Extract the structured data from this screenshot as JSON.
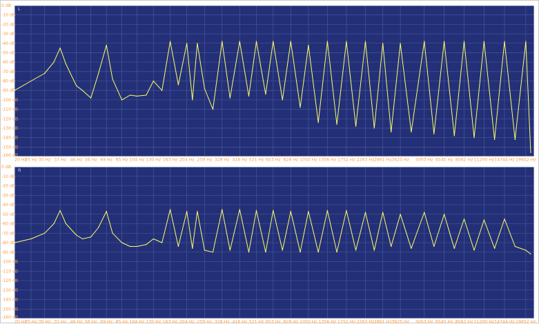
{
  "colors": {
    "plot_background": "#233078",
    "grid": "#4f5c9c",
    "trace": "#ffff66",
    "tick_label": "#ff9a3c",
    "frame": "#ffffff"
  },
  "chart_data": [
    {
      "type": "line",
      "channel_label": "L",
      "x_scale": "log",
      "y_unit": "dB",
      "ylim": [
        -160,
        0
      ],
      "y_ticks": [
        "0 dB",
        "-10 dB",
        "-20 dB",
        "-30 dB",
        "-40 dB",
        "-50 dB",
        "-60 dB",
        "-70 dB",
        "-80 dB",
        "-90 dB",
        "-100 dB",
        "-110 dB",
        "-120 dB",
        "-130 dB",
        "-140 dB",
        "-150 dB",
        "-160 dB"
      ],
      "x_ticks": [
        "20 Hz",
        "25 Hz",
        "30 Hz",
        "37 Hz",
        "46 Hz",
        "56 Hz",
        "69 Hz",
        "85 Hz",
        "104 Hz",
        "130 Hz",
        "163 Hz",
        "204 Hz",
        "259 Hz",
        "328 Hz",
        "416 Hz",
        "521 Hz",
        "653 Hz",
        "828 Hz",
        "1050 Hz",
        "1356 Hz",
        "1752 Hz",
        "2263 Hz",
        "2861 Hz",
        "3625 Hz",
        "5003 Hz",
        "6545 Hz",
        "8562 Hz",
        "11200 Hz",
        "14744 Hz",
        "19652 Hz"
      ],
      "grid": true,
      "series": [
        {
          "x": [
            20,
            25,
            30,
            34,
            37,
            40,
            46,
            50,
            56,
            62,
            69,
            75,
            85,
            95,
            104,
            118,
            130,
            146,
            163,
            182,
            204,
            220,
            235,
            259,
            290,
            328,
            365,
            416,
            470,
            521,
            590,
            653,
            740,
            828,
            940,
            1050,
            1200,
            1356,
            1540,
            1752,
            1990,
            2263,
            2550,
            2861,
            3200,
            3625,
            4200,
            5003,
            5700,
            6545,
            7500,
            8562,
            9800,
            11200,
            12900,
            14744,
            17000,
            19652,
            21000
          ],
          "y": [
            -90,
            -80,
            -72,
            -60,
            -45,
            -62,
            -85,
            -90,
            -98,
            -72,
            -42,
            -78,
            -100,
            -95,
            -96,
            -95,
            -80,
            -90,
            -38,
            -84,
            -40,
            -100,
            -40,
            -88,
            -110,
            -38,
            -98,
            -38,
            -96,
            -38,
            -94,
            -38,
            -100,
            -38,
            -108,
            -42,
            -124,
            -38,
            -126,
            -38,
            -128,
            -38,
            -130,
            -40,
            -134,
            -40,
            -134,
            -38,
            -136,
            -38,
            -138,
            -38,
            -140,
            -38,
            -142,
            -38,
            -142,
            -38,
            -156
          ]
        }
      ]
    },
    {
      "type": "line",
      "channel_label": "R",
      "x_scale": "log",
      "y_unit": "dB",
      "ylim": [
        -160,
        0
      ],
      "y_ticks": [
        "0 dB",
        "-10 dB",
        "-20 dB",
        "-30 dB",
        "-40 dB",
        "-50 dB",
        "-60 dB",
        "-70 dB",
        "-80 dB",
        "-90 dB",
        "-100 dB",
        "-110 dB",
        "-120 dB",
        "-130 dB",
        "-140 dB",
        "-150 dB",
        "-160 dB"
      ],
      "x_ticks": [
        "20 Hz",
        "25 Hz",
        "30 Hz",
        "37 Hz",
        "46 Hz",
        "56 Hz",
        "69 Hz",
        "85 Hz",
        "104 Hz",
        "130 Hz",
        "163 Hz",
        "204 Hz",
        "259 Hz",
        "328 Hz",
        "416 Hz",
        "521 Hz",
        "653 Hz",
        "828 Hz",
        "1050 Hz",
        "1356 Hz",
        "1752 Hz",
        "2263 Hz",
        "2861 Hz",
        "3625 Hz",
        "5003 Hz",
        "6545 Hz",
        "8562 Hz",
        "11200 Hz",
        "14744 Hz",
        "19652 Hz"
      ],
      "grid": true,
      "series": [
        {
          "x": [
            20,
            25,
            30,
            34,
            37,
            40,
            46,
            50,
            56,
            62,
            69,
            75,
            85,
            95,
            104,
            118,
            130,
            146,
            163,
            182,
            204,
            220,
            235,
            259,
            290,
            328,
            365,
            416,
            470,
            521,
            590,
            653,
            740,
            828,
            940,
            1050,
            1200,
            1356,
            1540,
            1752,
            1990,
            2263,
            2550,
            2861,
            3200,
            3625,
            4200,
            5003,
            5700,
            6545,
            7500,
            8562,
            9800,
            11200,
            12900,
            14744,
            17000,
            19652,
            21000
          ],
          "y": [
            -80,
            -76,
            -70,
            -60,
            -46,
            -60,
            -72,
            -76,
            -74,
            -64,
            -47,
            -70,
            -80,
            -84,
            -84,
            -82,
            -76,
            -80,
            -45,
            -84,
            -47,
            -86,
            -47,
            -88,
            -90,
            -45,
            -88,
            -45,
            -90,
            -46,
            -90,
            -46,
            -88,
            -47,
            -90,
            -47,
            -90,
            -46,
            -90,
            -46,
            -88,
            -48,
            -88,
            -48,
            -84,
            -50,
            -86,
            -48,
            -84,
            -50,
            -86,
            -55,
            -88,
            -56,
            -86,
            -55,
            -84,
            -88,
            -92
          ]
        }
      ]
    }
  ]
}
